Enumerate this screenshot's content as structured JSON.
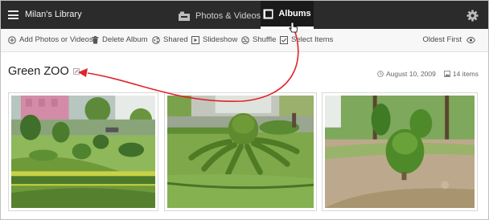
{
  "header": {
    "library_title": "Milan's Library",
    "nav": [
      {
        "label": "Photos & Videos",
        "icon": "photos-icon",
        "active": false
      },
      {
        "label": "Albums",
        "icon": "albums-icon",
        "active": true
      }
    ],
    "settings_icon": "gear-icon"
  },
  "toolbar": {
    "add": "Add Photos or Videos",
    "delete": "Delete Album",
    "shared": "Shared",
    "slideshow": "Slideshow",
    "shuffle": "Shuffle",
    "select": "Select Items",
    "sort": "Oldest First"
  },
  "album": {
    "title": "Green ZOO",
    "date": "August 10, 2009",
    "count": "14 items"
  },
  "photos": [
    {
      "subject": "topiary garden with pink building"
    },
    {
      "subject": "octopus-shaped topiary"
    },
    {
      "subject": "single topiary bush"
    }
  ],
  "colors": {
    "topbar": "#2b2b2b",
    "annotation_arrow": "#e0242b"
  }
}
